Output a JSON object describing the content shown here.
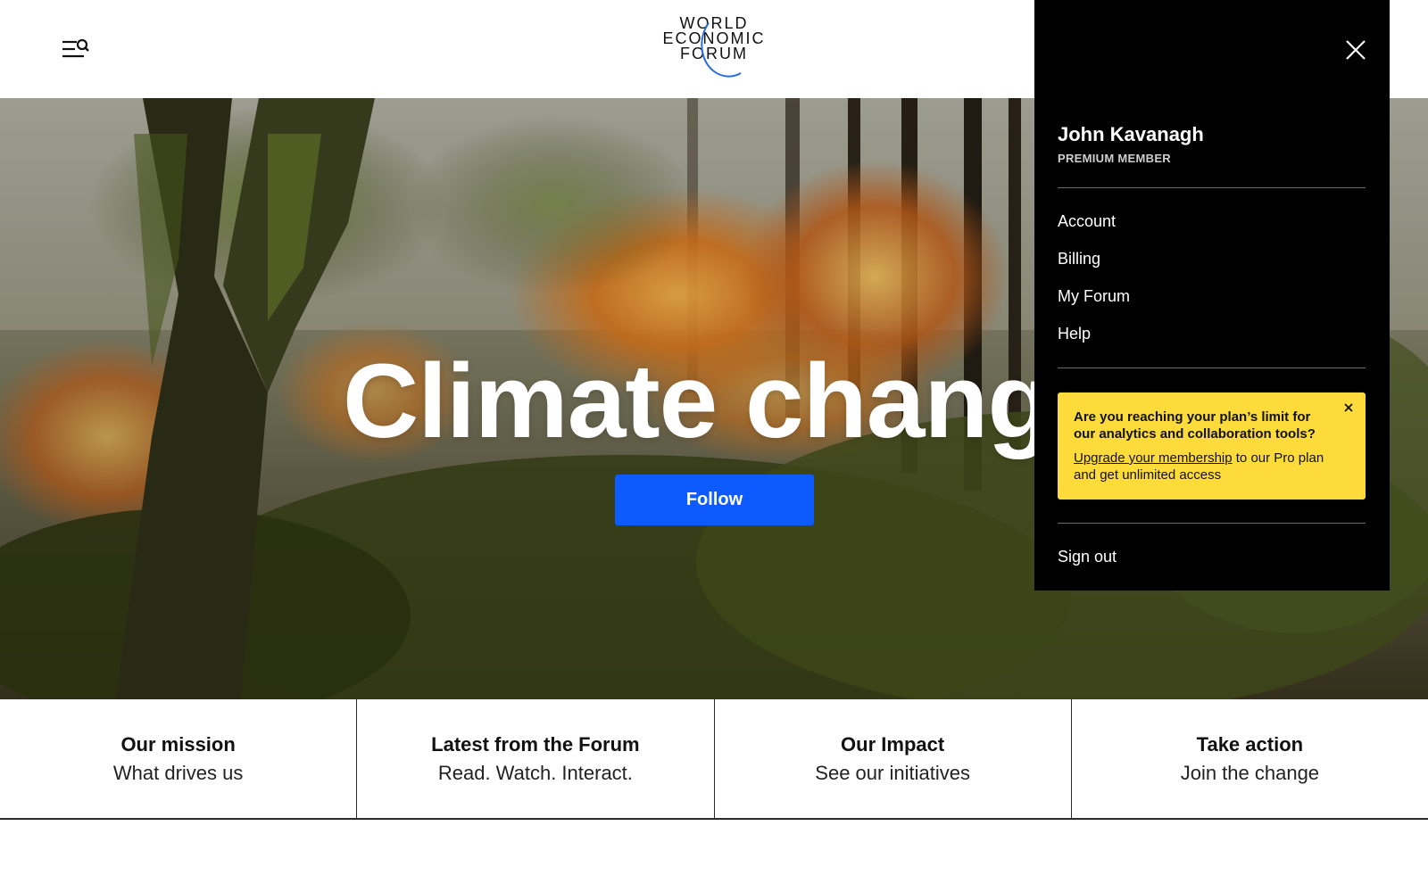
{
  "header": {
    "logo_lines": [
      "WORLD",
      "ECONOMIC",
      "FORUM"
    ],
    "menu_icon": "menu-search-icon"
  },
  "hero": {
    "title": "Climate change",
    "follow_label": "Follow"
  },
  "bottom_nav": [
    {
      "title": "Our mission",
      "subtitle": "What drives us"
    },
    {
      "title": "Latest from the Forum",
      "subtitle": "Read. Watch. Interact."
    },
    {
      "title": "Our Impact",
      "subtitle": "See our initiatives"
    },
    {
      "title": "Take action",
      "subtitle": "Join the change"
    }
  ],
  "account_menu": {
    "user_name": "John Kavanagh",
    "user_tier": "PREMIUM MEMBER",
    "links": [
      "Account",
      "Billing",
      "My Forum",
      "Help"
    ],
    "notice": {
      "title": "Are you reaching your plan’s limit for our analytics and collaboration tools?",
      "link_text": "Upgrade your membership",
      "body_rest": " to our Pro plan and get unlimited access"
    },
    "sign_out": "Sign out"
  },
  "colors": {
    "follow_button": "#0d5bff",
    "drawer_bg": "#000000",
    "notice_bg": "#fddb3a"
  }
}
